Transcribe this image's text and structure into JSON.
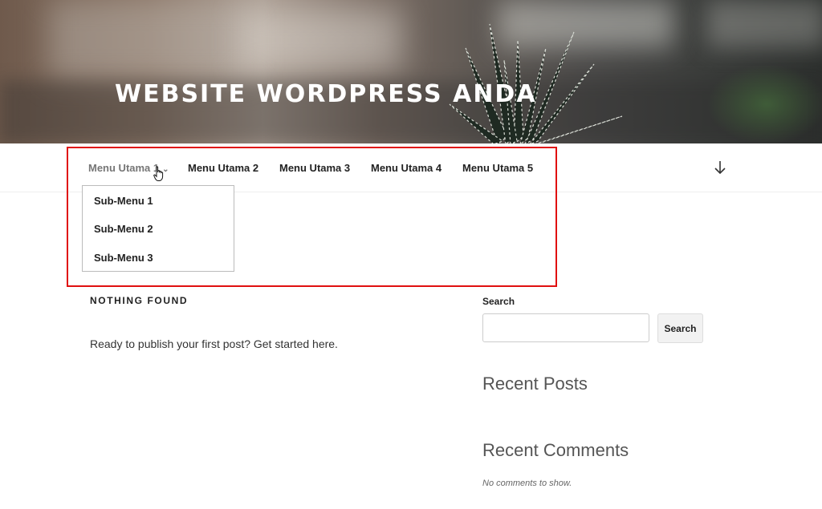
{
  "header": {
    "site_title": "WEBSITE WORDPRESS ANDA"
  },
  "nav": {
    "items": [
      {
        "label": "Menu Utama 1",
        "has_submenu": true,
        "active": true
      },
      {
        "label": "Menu Utama 2"
      },
      {
        "label": "Menu Utama 3"
      },
      {
        "label": "Menu Utama 4"
      },
      {
        "label": "Menu Utama 5"
      }
    ],
    "submenu": [
      "Sub-Menu 1",
      "Sub-Menu 2",
      "Sub-Menu 3"
    ],
    "scroll_icon": "arrow-down-icon",
    "chevron_icon": "chevron-down-icon",
    "highlight_color": "#e01010"
  },
  "main": {
    "heading": "NOTHING FOUND",
    "text": "Ready to publish your first post? Get started here."
  },
  "sidebar": {
    "search_label": "Search",
    "search_value": "",
    "search_button": "Search",
    "recent_posts_title": "Recent Posts",
    "recent_comments_title": "Recent Comments",
    "no_comments": "No comments to show."
  }
}
